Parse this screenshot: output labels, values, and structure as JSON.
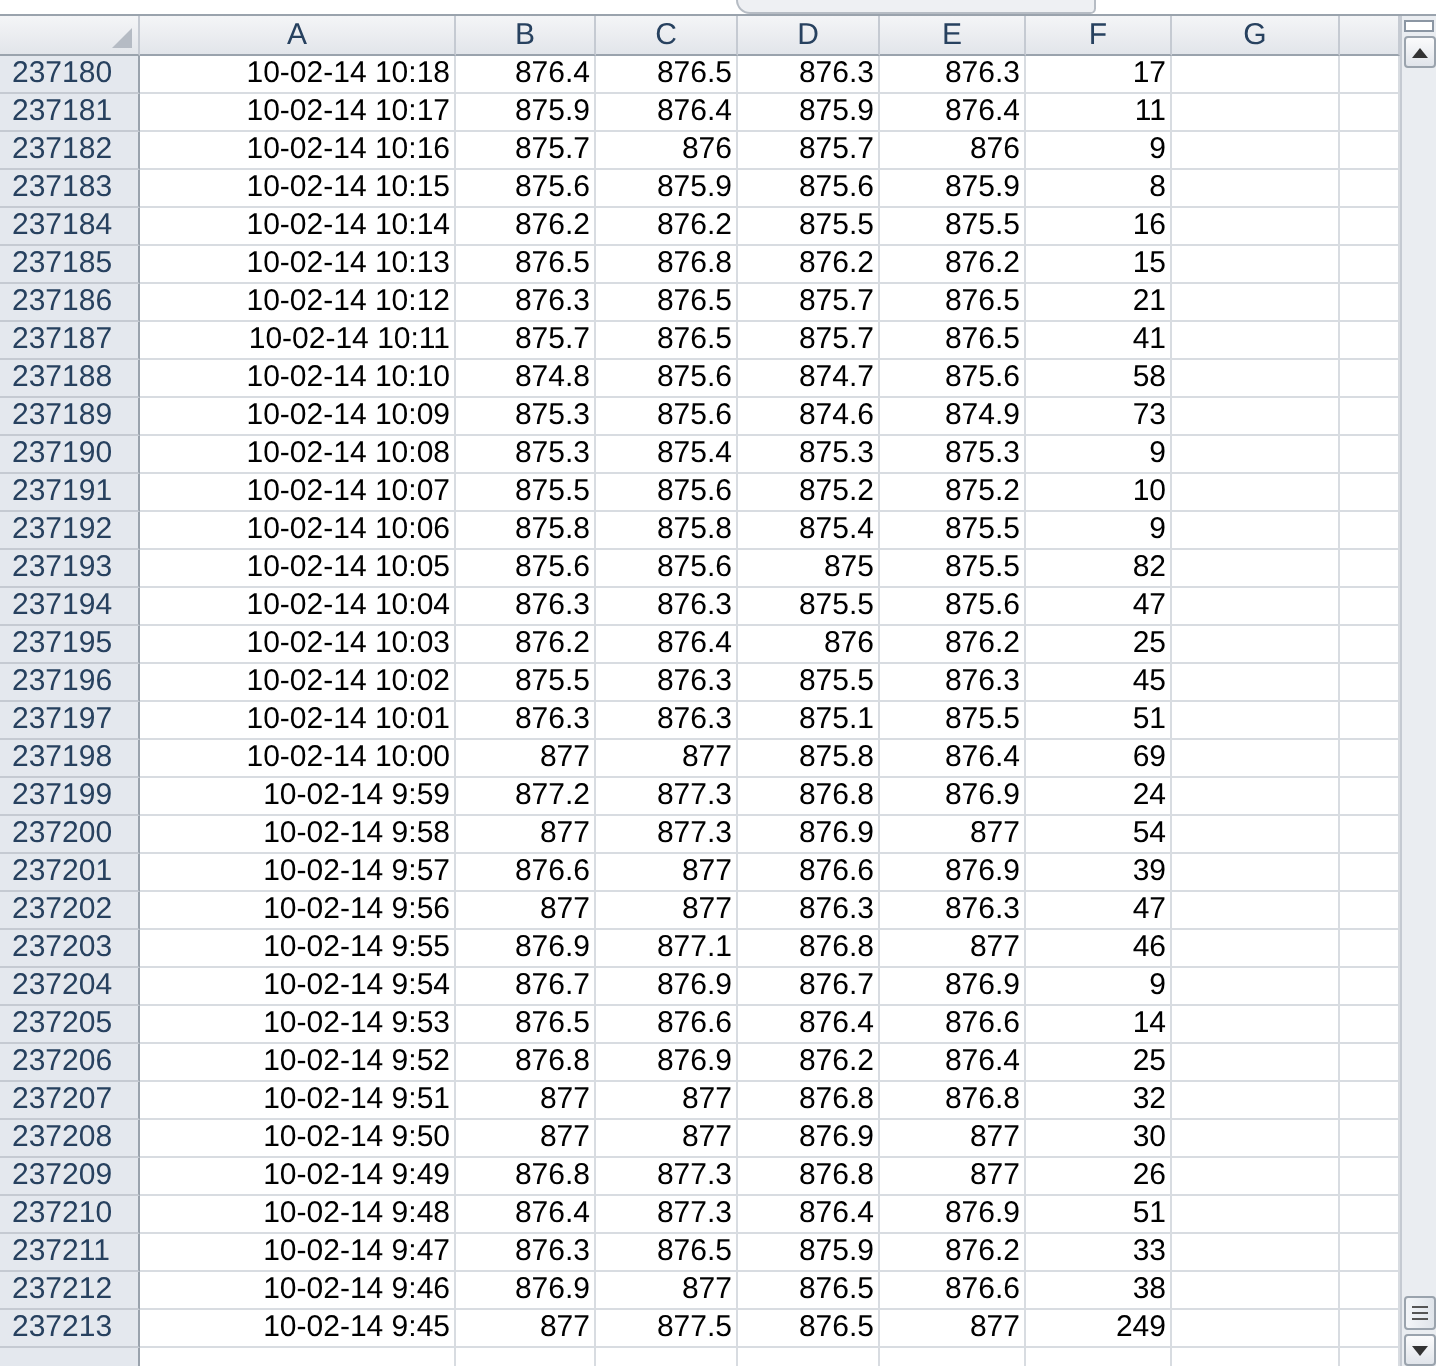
{
  "columns": [
    "A",
    "B",
    "C",
    "D",
    "E",
    "F",
    "G"
  ],
  "rows": [
    {
      "header": "237180",
      "cells": [
        "10-02-14 10:18",
        "876.4",
        "876.5",
        "876.3",
        "876.3",
        "17"
      ]
    },
    {
      "header": "237181",
      "cells": [
        "10-02-14 10:17",
        "875.9",
        "876.4",
        "875.9",
        "876.4",
        "11"
      ]
    },
    {
      "header": "237182",
      "cells": [
        "10-02-14 10:16",
        "875.7",
        "876",
        "875.7",
        "876",
        "9"
      ]
    },
    {
      "header": "237183",
      "cells": [
        "10-02-14 10:15",
        "875.6",
        "875.9",
        "875.6",
        "875.9",
        "8"
      ]
    },
    {
      "header": "237184",
      "cells": [
        "10-02-14 10:14",
        "876.2",
        "876.2",
        "875.5",
        "875.5",
        "16"
      ]
    },
    {
      "header": "237185",
      "cells": [
        "10-02-14 10:13",
        "876.5",
        "876.8",
        "876.2",
        "876.2",
        "15"
      ]
    },
    {
      "header": "237186",
      "cells": [
        "10-02-14 10:12",
        "876.3",
        "876.5",
        "875.7",
        "876.5",
        "21"
      ]
    },
    {
      "header": "237187",
      "cells": [
        "10-02-14 10:11",
        "875.7",
        "876.5",
        "875.7",
        "876.5",
        "41"
      ]
    },
    {
      "header": "237188",
      "cells": [
        "10-02-14 10:10",
        "874.8",
        "875.6",
        "874.7",
        "875.6",
        "58"
      ]
    },
    {
      "header": "237189",
      "cells": [
        "10-02-14 10:09",
        "875.3",
        "875.6",
        "874.6",
        "874.9",
        "73"
      ]
    },
    {
      "header": "237190",
      "cells": [
        "10-02-14 10:08",
        "875.3",
        "875.4",
        "875.3",
        "875.3",
        "9"
      ]
    },
    {
      "header": "237191",
      "cells": [
        "10-02-14 10:07",
        "875.5",
        "875.6",
        "875.2",
        "875.2",
        "10"
      ]
    },
    {
      "header": "237192",
      "cells": [
        "10-02-14 10:06",
        "875.8",
        "875.8",
        "875.4",
        "875.5",
        "9"
      ]
    },
    {
      "header": "237193",
      "cells": [
        "10-02-14 10:05",
        "875.6",
        "875.6",
        "875",
        "875.5",
        "82"
      ]
    },
    {
      "header": "237194",
      "cells": [
        "10-02-14 10:04",
        "876.3",
        "876.3",
        "875.5",
        "875.6",
        "47"
      ]
    },
    {
      "header": "237195",
      "cells": [
        "10-02-14 10:03",
        "876.2",
        "876.4",
        "876",
        "876.2",
        "25"
      ]
    },
    {
      "header": "237196",
      "cells": [
        "10-02-14 10:02",
        "875.5",
        "876.3",
        "875.5",
        "876.3",
        "45"
      ]
    },
    {
      "header": "237197",
      "cells": [
        "10-02-14 10:01",
        "876.3",
        "876.3",
        "875.1",
        "875.5",
        "51"
      ]
    },
    {
      "header": "237198",
      "cells": [
        "10-02-14 10:00",
        "877",
        "877",
        "875.8",
        "876.4",
        "69"
      ]
    },
    {
      "header": "237199",
      "cells": [
        "10-02-14 9:59",
        "877.2",
        "877.3",
        "876.8",
        "876.9",
        "24"
      ]
    },
    {
      "header": "237200",
      "cells": [
        "10-02-14 9:58",
        "877",
        "877.3",
        "876.9",
        "877",
        "54"
      ]
    },
    {
      "header": "237201",
      "cells": [
        "10-02-14 9:57",
        "876.6",
        "877",
        "876.6",
        "876.9",
        "39"
      ]
    },
    {
      "header": "237202",
      "cells": [
        "10-02-14 9:56",
        "877",
        "877",
        "876.3",
        "876.3",
        "47"
      ]
    },
    {
      "header": "237203",
      "cells": [
        "10-02-14 9:55",
        "876.9",
        "877.1",
        "876.8",
        "877",
        "46"
      ]
    },
    {
      "header": "237204",
      "cells": [
        "10-02-14 9:54",
        "876.7",
        "876.9",
        "876.7",
        "876.9",
        "9"
      ]
    },
    {
      "header": "237205",
      "cells": [
        "10-02-14 9:53",
        "876.5",
        "876.6",
        "876.4",
        "876.6",
        "14"
      ]
    },
    {
      "header": "237206",
      "cells": [
        "10-02-14 9:52",
        "876.8",
        "876.9",
        "876.2",
        "876.4",
        "25"
      ]
    },
    {
      "header": "237207",
      "cells": [
        "10-02-14 9:51",
        "877",
        "877",
        "876.8",
        "876.8",
        "32"
      ]
    },
    {
      "header": "237208",
      "cells": [
        "10-02-14 9:50",
        "877",
        "877",
        "876.9",
        "877",
        "30"
      ]
    },
    {
      "header": "237209",
      "cells": [
        "10-02-14 9:49",
        "876.8",
        "877.3",
        "876.8",
        "877",
        "26"
      ]
    },
    {
      "header": "237210",
      "cells": [
        "10-02-14 9:48",
        "876.4",
        "877.3",
        "876.4",
        "876.9",
        "51"
      ]
    },
    {
      "header": "237211",
      "cells": [
        "10-02-14 9:47",
        "876.3",
        "876.5",
        "875.9",
        "876.2",
        "33"
      ]
    },
    {
      "header": "237212",
      "cells": [
        "10-02-14 9:46",
        "876.9",
        "877",
        "876.5",
        "876.6",
        "38"
      ]
    },
    {
      "header": "237213",
      "cells": [
        "10-02-14 9:45",
        "877",
        "877.5",
        "876.5",
        "877",
        "249"
      ]
    }
  ]
}
